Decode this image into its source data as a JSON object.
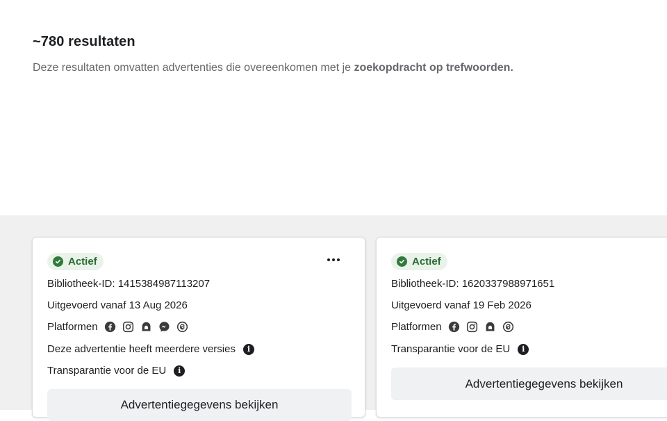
{
  "results": {
    "count_label": "~780 resultaten",
    "description_prefix": "Deze resultaten omvatten advertenties die overeenkomen met je ",
    "description_bold": "zoekopdracht op trefwoorden."
  },
  "cards": [
    {
      "status": "Actief",
      "library_id": "Bibliotheek-ID: 1415384987113207",
      "run_since": "Uitgevoerd vanaf 13 Aug 2026",
      "platforms_label": "Platformen",
      "platforms": [
        "facebook-icon",
        "instagram-icon",
        "audience-network-icon",
        "messenger-icon",
        "threads-icon"
      ],
      "versions_note": "Deze advertentie heeft meerdere versies",
      "eu_transparency": "Transparantie voor de EU",
      "details_button": "Advertentiegegevens bekijken"
    },
    {
      "status": "Actief",
      "library_id": "Bibliotheek-ID: 1620337988971651",
      "run_since": "Uitgevoerd vanaf 19 Feb 2026",
      "platforms_label": "Platformen",
      "platforms": [
        "facebook-icon",
        "instagram-icon",
        "audience-network-icon",
        "threads-icon"
      ],
      "eu_transparency": "Transparantie voor de EU",
      "details_button": "Advertentiegegevens bekijken"
    }
  ],
  "colors": {
    "active_badge_bg": "#e9f3ea",
    "active_badge_text": "#2b6b33",
    "page_bg": "#f0f0f0"
  }
}
